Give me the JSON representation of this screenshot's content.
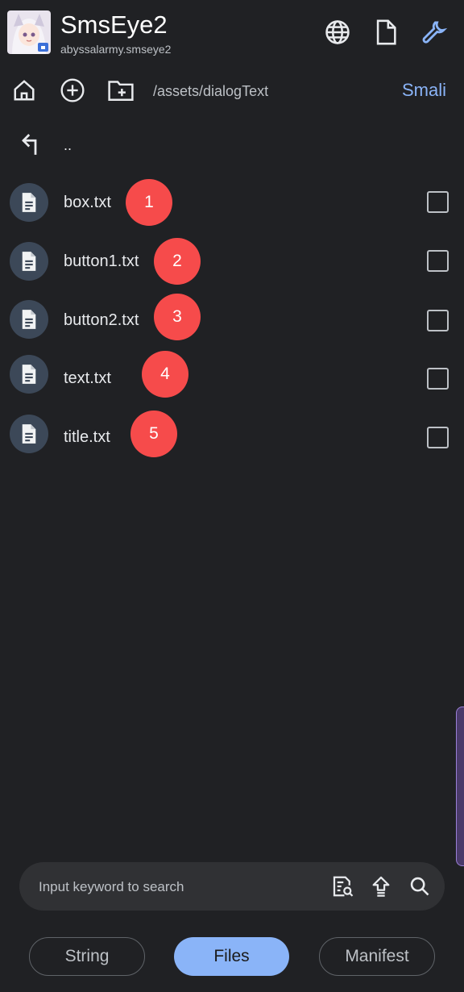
{
  "header": {
    "title": "SmsEye2",
    "package": "abyssalarmy.smseye2",
    "icons": [
      "globe-icon",
      "file-icon",
      "wrench-icon"
    ]
  },
  "toolbar": {
    "path": "/assets/dialogText",
    "smali_label": "Smali",
    "icons": [
      "home-icon",
      "add-circle-icon",
      "new-folder-icon"
    ]
  },
  "parent": {
    "label": ".."
  },
  "files": [
    {
      "name": "box.txt",
      "badge": "1"
    },
    {
      "name": "button1.txt",
      "badge": "2"
    },
    {
      "name": "button2.txt",
      "badge": "3"
    },
    {
      "name": "text.txt",
      "badge": "4"
    },
    {
      "name": "title.txt",
      "badge": "5"
    }
  ],
  "search": {
    "placeholder": "Input keyword to search",
    "icons": [
      "find-in-page-icon",
      "upload-icon",
      "search-icon"
    ]
  },
  "tabs": [
    {
      "label": "String",
      "active": false
    },
    {
      "label": "Files",
      "active": true
    },
    {
      "label": "Manifest",
      "active": false
    }
  ],
  "colors": {
    "background": "#202124",
    "accent": "#8ab4f8",
    "badge": "#f64b4b"
  }
}
